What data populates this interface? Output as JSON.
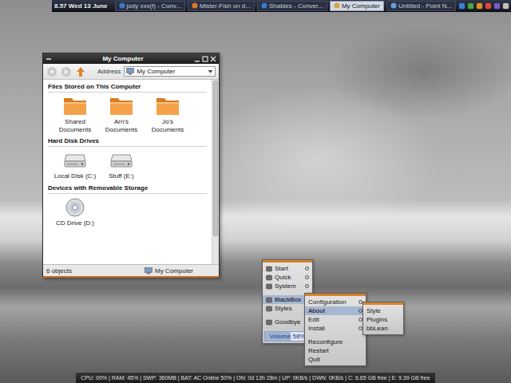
{
  "taskbar": {
    "clock": "8.57 Wed 13 June",
    "tasks": [
      {
        "label": "jody xxx(f) - Conv...",
        "selected": false
      },
      {
        "label": "Mister-Fish on d...",
        "selected": false
      },
      {
        "label": "Shabies - Conver...",
        "selected": false
      },
      {
        "label": "My Computer",
        "selected": true
      },
      {
        "label": "Untitled - Point N...",
        "selected": false
      }
    ]
  },
  "explorer": {
    "title": "My Computer",
    "address_label": "Address",
    "address": "My Computer",
    "groups": [
      {
        "title": "Files Stored on This Computer",
        "items": [
          {
            "label": "Shared Documents",
            "kind": "folder"
          },
          {
            "label": "Arn's Documents",
            "kind": "folder"
          },
          {
            "label": "Jo's Documents",
            "kind": "folder"
          }
        ]
      },
      {
        "title": "Hard Disk Drives",
        "items": [
          {
            "label": "Local Disk (C:)",
            "kind": "disk"
          },
          {
            "label": "Stuff (E:)",
            "kind": "disk"
          }
        ]
      },
      {
        "title": "Devices with Removable Storage",
        "items": [
          {
            "label": "CD Drive (D:)",
            "kind": "cd"
          }
        ]
      }
    ],
    "status": {
      "count": "6 objects",
      "location": "My Computer"
    }
  },
  "root_menu": {
    "items": [
      {
        "label": "Start",
        "kind": "submenu",
        "selected": false
      },
      {
        "label": "Quick",
        "kind": "submenu",
        "selected": false
      },
      {
        "label": "System",
        "kind": "submenu",
        "selected": false
      },
      {
        "kind": "separator"
      },
      {
        "label": "BlackBox",
        "kind": "submenu",
        "selected": true
      },
      {
        "label": "Styles",
        "kind": "submenu",
        "selected": false
      },
      {
        "kind": "separator"
      },
      {
        "label": "Goodbye",
        "kind": "submenu",
        "selected": false
      },
      {
        "kind": "separator"
      },
      {
        "label": "Volume 58%",
        "kind": "slider",
        "level": 0.58
      }
    ]
  },
  "blackbox_menu": {
    "items": [
      {
        "label": "Configuration",
        "kind": "submenu",
        "selected": false
      },
      {
        "label": "About",
        "kind": "submenu",
        "selected": true
      },
      {
        "label": "Edit",
        "kind": "submenu",
        "selected": false
      },
      {
        "label": "Install",
        "kind": "submenu",
        "selected": false
      },
      {
        "kind": "separator"
      },
      {
        "label": "Reconfigure",
        "kind": "command",
        "selected": false
      },
      {
        "label": "Restart",
        "kind": "command",
        "selected": false
      },
      {
        "label": "Quit",
        "kind": "command",
        "selected": false
      }
    ]
  },
  "about_menu": {
    "items": [
      {
        "label": "Style",
        "kind": "command",
        "selected": false
      },
      {
        "label": "Plugins",
        "kind": "command",
        "selected": false
      },
      {
        "label": "bbLean",
        "kind": "command",
        "selected": false
      }
    ]
  },
  "status_bar": {
    "text": "CPU: 00% | RAM: 45% | SWP: 360MB | BAT: AC Online 50% | ON: 0d 13h 28m | UP: 0KB/s | DWN: 0KB/s | C: 6.65 GB free | E: 9.39 GB free"
  }
}
